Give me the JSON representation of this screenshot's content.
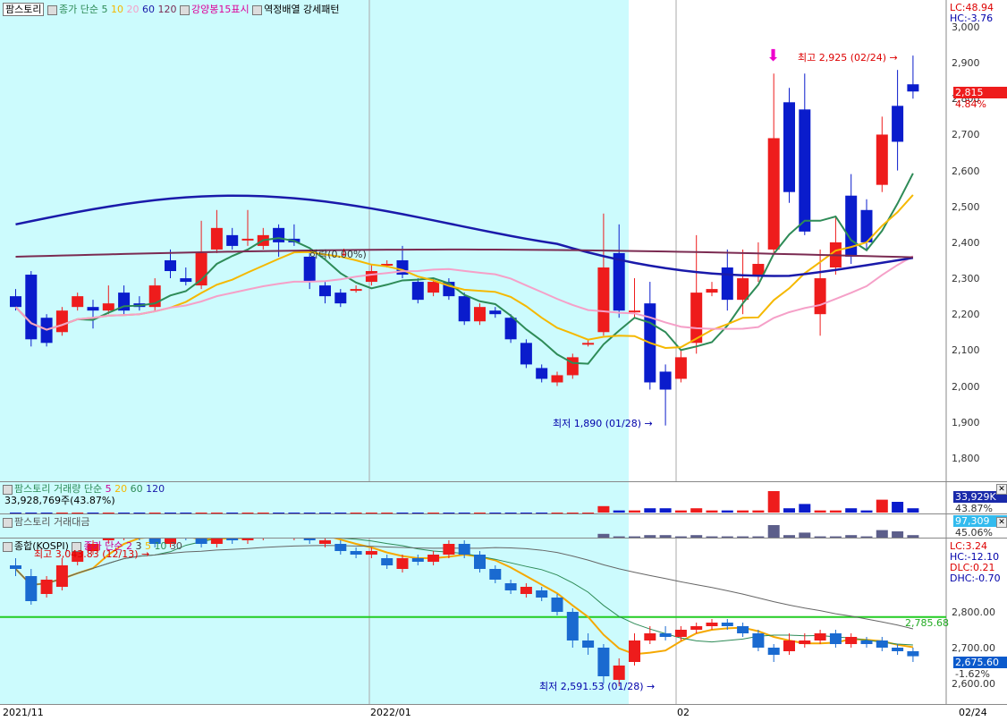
{
  "colors": {
    "up": "#ee1c1c",
    "down": "#0a1ccc",
    "highlight": "#ccfbfd",
    "ma5": "#2e8b57",
    "ma10": "#f5b800",
    "ma20": "#f5a0c8",
    "ma60": "#1a1aaa",
    "ma120": "#7b2b52",
    "hline": "#22cc22",
    "price_badge": "#ee1c1c",
    "vol_badge": "#1a2aaa",
    "amt_badge": "#33bbee",
    "kospi_badge": "#0a5acc"
  },
  "main": {
    "title": "팜스토리",
    "legend": {
      "ma_label": "종가 단순",
      "p5": "5",
      "p10": "10",
      "p20": "20",
      "p60": "60",
      "p120": "120",
      "strong": "강양봉15표시",
      "pattern": "역정배열 강세패턴"
    },
    "lc": "LC:48.94",
    "hc": "HC:-3.76",
    "price_badge": "2,815",
    "pct": "4.84%",
    "high_note": "최고 2,925 (02/24)",
    "low_note": "최저 1,890 (01/28)",
    "mid_note": "하락(0.00%)",
    "y_ticks": [
      "3,000",
      "2,900",
      "2,800",
      "2,700",
      "2,600",
      "2,500",
      "2,400",
      "2,300",
      "2,200",
      "2,100",
      "2,000",
      "1,900",
      "1,800"
    ]
  },
  "volume": {
    "title": "팜스토리 거래량",
    "ma_label": "단순",
    "p5": "5",
    "p20": "20",
    "p60": "60",
    "p120": "120",
    "value_text": "33,928,769주(43.87%)",
    "badge": "33,929K",
    "pct": "43.87%"
  },
  "amount": {
    "title": "팜스토리 거래대금",
    "badge": "97,309",
    "pct": "45.06%"
  },
  "kospi": {
    "title": "종합(KOSPI)",
    "ma_label": "종가 단순",
    "p2": "2",
    "p3": "3",
    "p5": "5",
    "p10": "10",
    "p30": "30",
    "lc": "LC:3.24",
    "hc": "HC:-12.10",
    "dlc": "DLC:0.21",
    "dhc": "DHC:-0.70",
    "high_note": "최고 3,043.83 (12/13)",
    "low_note": "최저 2,591.53 (01/28)",
    "hline_value": "2,785.68",
    "badge": "2,675.60",
    "pct": "-1.62%",
    "y_ticks": [
      "2,800.00",
      "2,700.00",
      "2,600.00"
    ]
  },
  "x_axis": {
    "labels": [
      "2021/11",
      "2022/01",
      "02",
      "02/24"
    ]
  },
  "candles": [
    [
      2250,
      2220,
      2270,
      2210
    ],
    [
      2310,
      2130,
      2320,
      2110
    ],
    [
      2190,
      2120,
      2200,
      2110
    ],
    [
      2150,
      2210,
      2220,
      2140
    ],
    [
      2220,
      2250,
      2260,
      2210
    ],
    [
      2220,
      2210,
      2240,
      2160
    ],
    [
      2210,
      2230,
      2280,
      2200
    ],
    [
      2260,
      2210,
      2280,
      2200
    ],
    [
      2230,
      2220,
      2250,
      2210
    ],
    [
      2220,
      2280,
      2300,
      2210
    ],
    [
      2350,
      2320,
      2380,
      2300
    ],
    [
      2300,
      2290,
      2330,
      2280
    ],
    [
      2280,
      2370,
      2460,
      2270
    ],
    [
      2380,
      2440,
      2490,
      2370
    ],
    [
      2420,
      2390,
      2440,
      2380
    ],
    [
      2410,
      2410,
      2490,
      2390
    ],
    [
      2390,
      2420,
      2440,
      2380
    ],
    [
      2440,
      2400,
      2450,
      2360
    ],
    [
      2410,
      2400,
      2450,
      2390
    ],
    [
      2360,
      2290,
      2370,
      2270
    ],
    [
      2280,
      2250,
      2290,
      2230
    ],
    [
      2260,
      2230,
      2270,
      2220
    ],
    [
      2270,
      2270,
      2280,
      2260
    ],
    [
      2290,
      2320,
      2340,
      2280
    ],
    [
      2340,
      2340,
      2350,
      2330
    ],
    [
      2350,
      2310,
      2390,
      2300
    ],
    [
      2290,
      2240,
      2300,
      2230
    ],
    [
      2260,
      2290,
      2300,
      2250
    ],
    [
      2290,
      2250,
      2300,
      2240
    ],
    [
      2250,
      2180,
      2260,
      2170
    ],
    [
      2180,
      2220,
      2230,
      2170
    ],
    [
      2210,
      2200,
      2220,
      2190
    ],
    [
      2190,
      2130,
      2200,
      2120
    ],
    [
      2120,
      2060,
      2130,
      2050
    ],
    [
      2050,
      2020,
      2060,
      2010
    ],
    [
      2010,
      2030,
      2040,
      2000
    ],
    [
      2030,
      2080,
      2090,
      2020
    ],
    [
      2120,
      2120,
      2130,
      2110
    ],
    [
      2150,
      2330,
      2480,
      2140
    ],
    [
      2370,
      2210,
      2450,
      2190
    ],
    [
      2210,
      2210,
      2300,
      2190
    ],
    [
      2230,
      2010,
      2290,
      1990
    ],
    [
      2040,
      1990,
      2060,
      1890
    ],
    [
      2020,
      2080,
      2100,
      2010
    ],
    [
      2120,
      2260,
      2420,
      2090
    ],
    [
      2260,
      2270,
      2290,
      2250
    ],
    [
      2330,
      2240,
      2380,
      2210
    ],
    [
      2240,
      2300,
      2380,
      2200
    ],
    [
      2310,
      2340,
      2400,
      2290
    ],
    [
      2380,
      2690,
      2870,
      2370
    ],
    [
      2790,
      2540,
      2830,
      2510
    ],
    [
      2770,
      2430,
      2870,
      2420
    ],
    [
      2200,
      2300,
      2380,
      2140
    ],
    [
      2330,
      2400,
      2470,
      2310
    ],
    [
      2530,
      2360,
      2590,
      2340
    ],
    [
      2490,
      2400,
      2520,
      2380
    ],
    [
      2560,
      2700,
      2750,
      2540
    ],
    [
      2780,
      2680,
      2880,
      2600
    ],
    [
      2840,
      2820,
      2920,
      2800
    ]
  ],
  "kospi_candles": [
    [
      2930,
      2920,
      2950,
      2900
    ],
    [
      2900,
      2830,
      2920,
      2820
    ],
    [
      2850,
      2890,
      2900,
      2840
    ],
    [
      2870,
      2930,
      2950,
      2860
    ],
    [
      2940,
      2970,
      2980,
      2930
    ],
    [
      2970,
      2990,
      3000,
      2960
    ],
    [
      3000,
      3020,
      3044,
      2990
    ],
    [
      3010,
      3040,
      3044,
      3000
    ],
    [
      3040,
      3010,
      3044,
      3000
    ],
    [
      3010,
      2990,
      3020,
      2980
    ],
    [
      2990,
      3010,
      3030,
      2980
    ],
    [
      3020,
      3010,
      3030,
      3000
    ],
    [
      3010,
      2990,
      3020,
      2980
    ],
    [
      2990,
      3020,
      3030,
      2980
    ],
    [
      3020,
      3000,
      3030,
      2990
    ],
    [
      3000,
      3010,
      3020,
      2990
    ],
    [
      3010,
      3030,
      3040,
      3000
    ],
    [
      3030,
      3020,
      3040,
      3010
    ],
    [
      3010,
      3020,
      3030,
      3000
    ],
    [
      3020,
      3000,
      3030,
      2990
    ],
    [
      2990,
      3000,
      3010,
      2980
    ],
    [
      2990,
      2970,
      3000,
      2960
    ],
    [
      2970,
      2960,
      2980,
      2950
    ],
    [
      2960,
      2970,
      2980,
      2950
    ],
    [
      2950,
      2930,
      2960,
      2920
    ],
    [
      2920,
      2950,
      2960,
      2910
    ],
    [
      2950,
      2940,
      2960,
      2930
    ],
    [
      2940,
      2960,
      2970,
      2930
    ],
    [
      2960,
      2990,
      3000,
      2950
    ],
    [
      2990,
      2960,
      3000,
      2950
    ],
    [
      2960,
      2920,
      2970,
      2910
    ],
    [
      2920,
      2890,
      2930,
      2880
    ],
    [
      2880,
      2860,
      2890,
      2850
    ],
    [
      2850,
      2870,
      2880,
      2840
    ],
    [
      2860,
      2840,
      2870,
      2830
    ],
    [
      2840,
      2800,
      2850,
      2790
    ],
    [
      2800,
      2720,
      2810,
      2700
    ],
    [
      2720,
      2700,
      2740,
      2680
    ],
    [
      2700,
      2620,
      2710,
      2600
    ],
    [
      2610,
      2650,
      2670,
      2592
    ],
    [
      2660,
      2720,
      2740,
      2650
    ],
    [
      2720,
      2740,
      2760,
      2710
    ],
    [
      2740,
      2730,
      2760,
      2720
    ],
    [
      2730,
      2750,
      2760,
      2720
    ],
    [
      2750,
      2760,
      2770,
      2740
    ],
    [
      2760,
      2770,
      2780,
      2750
    ],
    [
      2770,
      2760,
      2780,
      2750
    ],
    [
      2760,
      2740,
      2770,
      2730
    ],
    [
      2740,
      2700,
      2750,
      2690
    ],
    [
      2700,
      2680,
      2710,
      2660
    ],
    [
      2690,
      2720,
      2740,
      2680
    ],
    [
      2710,
      2720,
      2740,
      2700
    ],
    [
      2720,
      2740,
      2750,
      2710
    ],
    [
      2740,
      2710,
      2750,
      2700
    ],
    [
      2710,
      2730,
      2740,
      2700
    ],
    [
      2720,
      2710,
      2730,
      2700
    ],
    [
      2720,
      2700,
      2730,
      2690
    ],
    [
      2700,
      2690,
      2710,
      2680
    ],
    [
      2690,
      2676,
      2700,
      2660
    ]
  ],
  "volumes": [
    0,
    0,
    0,
    0,
    0,
    0,
    0,
    0,
    0,
    0,
    0,
    0,
    0,
    0,
    0,
    0,
    0,
    0,
    0,
    0,
    0,
    0,
    0,
    0,
    0,
    0,
    0,
    0,
    0,
    0,
    0,
    0,
    0,
    0,
    0,
    0,
    0,
    0,
    3,
    1,
    1,
    2,
    2,
    1,
    2,
    1,
    1,
    1,
    1,
    10,
    2,
    4,
    1,
    1,
    2,
    1,
    6,
    5,
    2
  ]
}
